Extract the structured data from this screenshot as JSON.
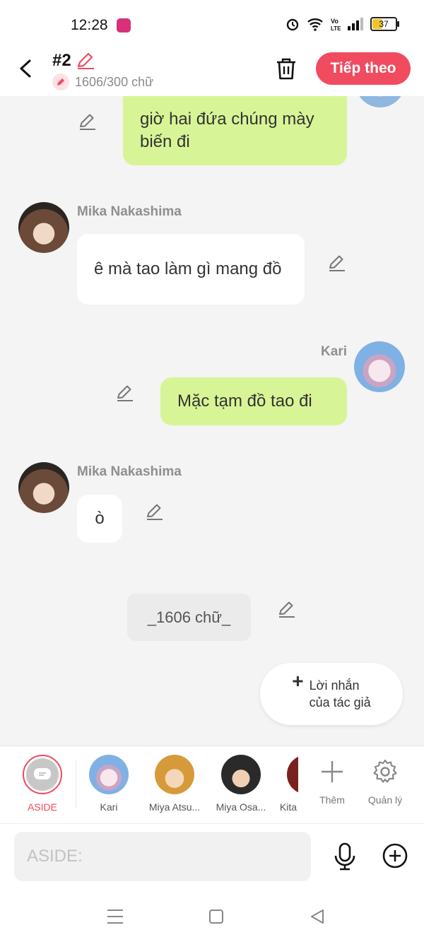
{
  "status_bar": {
    "time": "12:28",
    "battery": "37"
  },
  "header": {
    "title": "#2",
    "word_count": "1606/300 chữ",
    "next_label": "Tiếp theo"
  },
  "messages": [
    {
      "speaker": "",
      "text": "giờ hai đứa chúng mày biến đi"
    },
    {
      "speaker": "Mika Nakashima",
      "text": "ê mà tao làm gì mang đồ"
    },
    {
      "speaker": "Kari",
      "text": "Mặc tạm đồ tao đi"
    },
    {
      "speaker": "Mika Nakashima",
      "text": "ò"
    }
  ],
  "aside_note": "_1606 chữ_",
  "author_message_label": "Lời nhắn\ncủa tác giả",
  "characters": [
    {
      "label": "ASIDE",
      "selected": true
    },
    {
      "label": "Kari"
    },
    {
      "label": "Miya Atsu..."
    },
    {
      "label": "Miya Osa..."
    },
    {
      "label": "Kita"
    }
  ],
  "tools": {
    "add_label": "Thêm",
    "manage_label": "Quản lý"
  },
  "input": {
    "placeholder": "ASIDE:"
  },
  "colors": {
    "accent": "#f04b5f",
    "bubble_green": "#d7f596",
    "background": "#f4f4f4"
  }
}
